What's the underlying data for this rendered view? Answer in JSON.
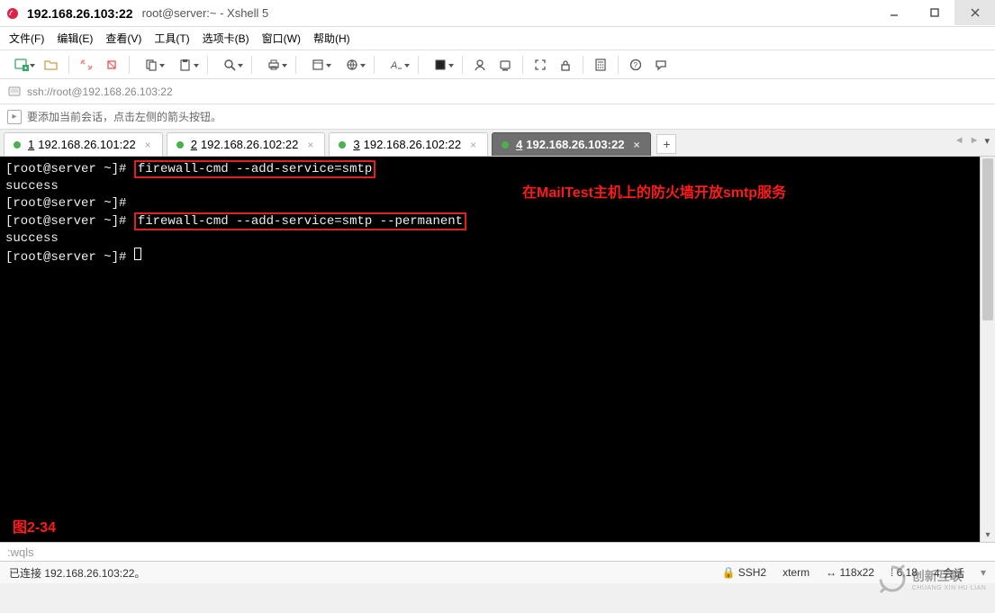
{
  "window": {
    "title": "192.168.26.103:22",
    "subtitle": "root@server:~ - Xshell 5"
  },
  "menu": {
    "file": "文件(F)",
    "edit": "编辑(E)",
    "view": "查看(V)",
    "tools": "工具(T)",
    "tabs": "选项卡(B)",
    "window": "窗口(W)",
    "help": "帮助(H)"
  },
  "addressbar": {
    "url": "ssh://root@192.168.26.103:22"
  },
  "tipbar": {
    "text": "要添加当前会话，点击左侧的箭头按钮。"
  },
  "tabs": [
    {
      "num": "1",
      "label": "192.168.26.101:22",
      "active": false
    },
    {
      "num": "2",
      "label": "192.168.26.102:22",
      "active": false
    },
    {
      "num": "3",
      "label": "192.168.26.102:22",
      "active": false
    },
    {
      "num": "4",
      "label": "192.168.26.103:22",
      "active": true
    }
  ],
  "terminal": {
    "prompt": "[root@server ~]#",
    "cmd1": "firewall-cmd --add-service=smtp",
    "ok": "success",
    "cmd2": "firewall-cmd --add-service=smtp --permanent",
    "annotation": "在MailTest主机上的防火墙开放smtp服务",
    "figure_label": "图2-34"
  },
  "cmdrow": {
    "text": ":wqls"
  },
  "statusbar": {
    "connected": "已连接 192.168.26.103:22。",
    "ssh": "SSH2",
    "term": "xterm",
    "size": "118x22",
    "pos": "6,18",
    "sessions": "4 会话"
  },
  "watermark": {
    "main": "创新互联",
    "sub": "CHUANG XIN HU LIAN"
  }
}
